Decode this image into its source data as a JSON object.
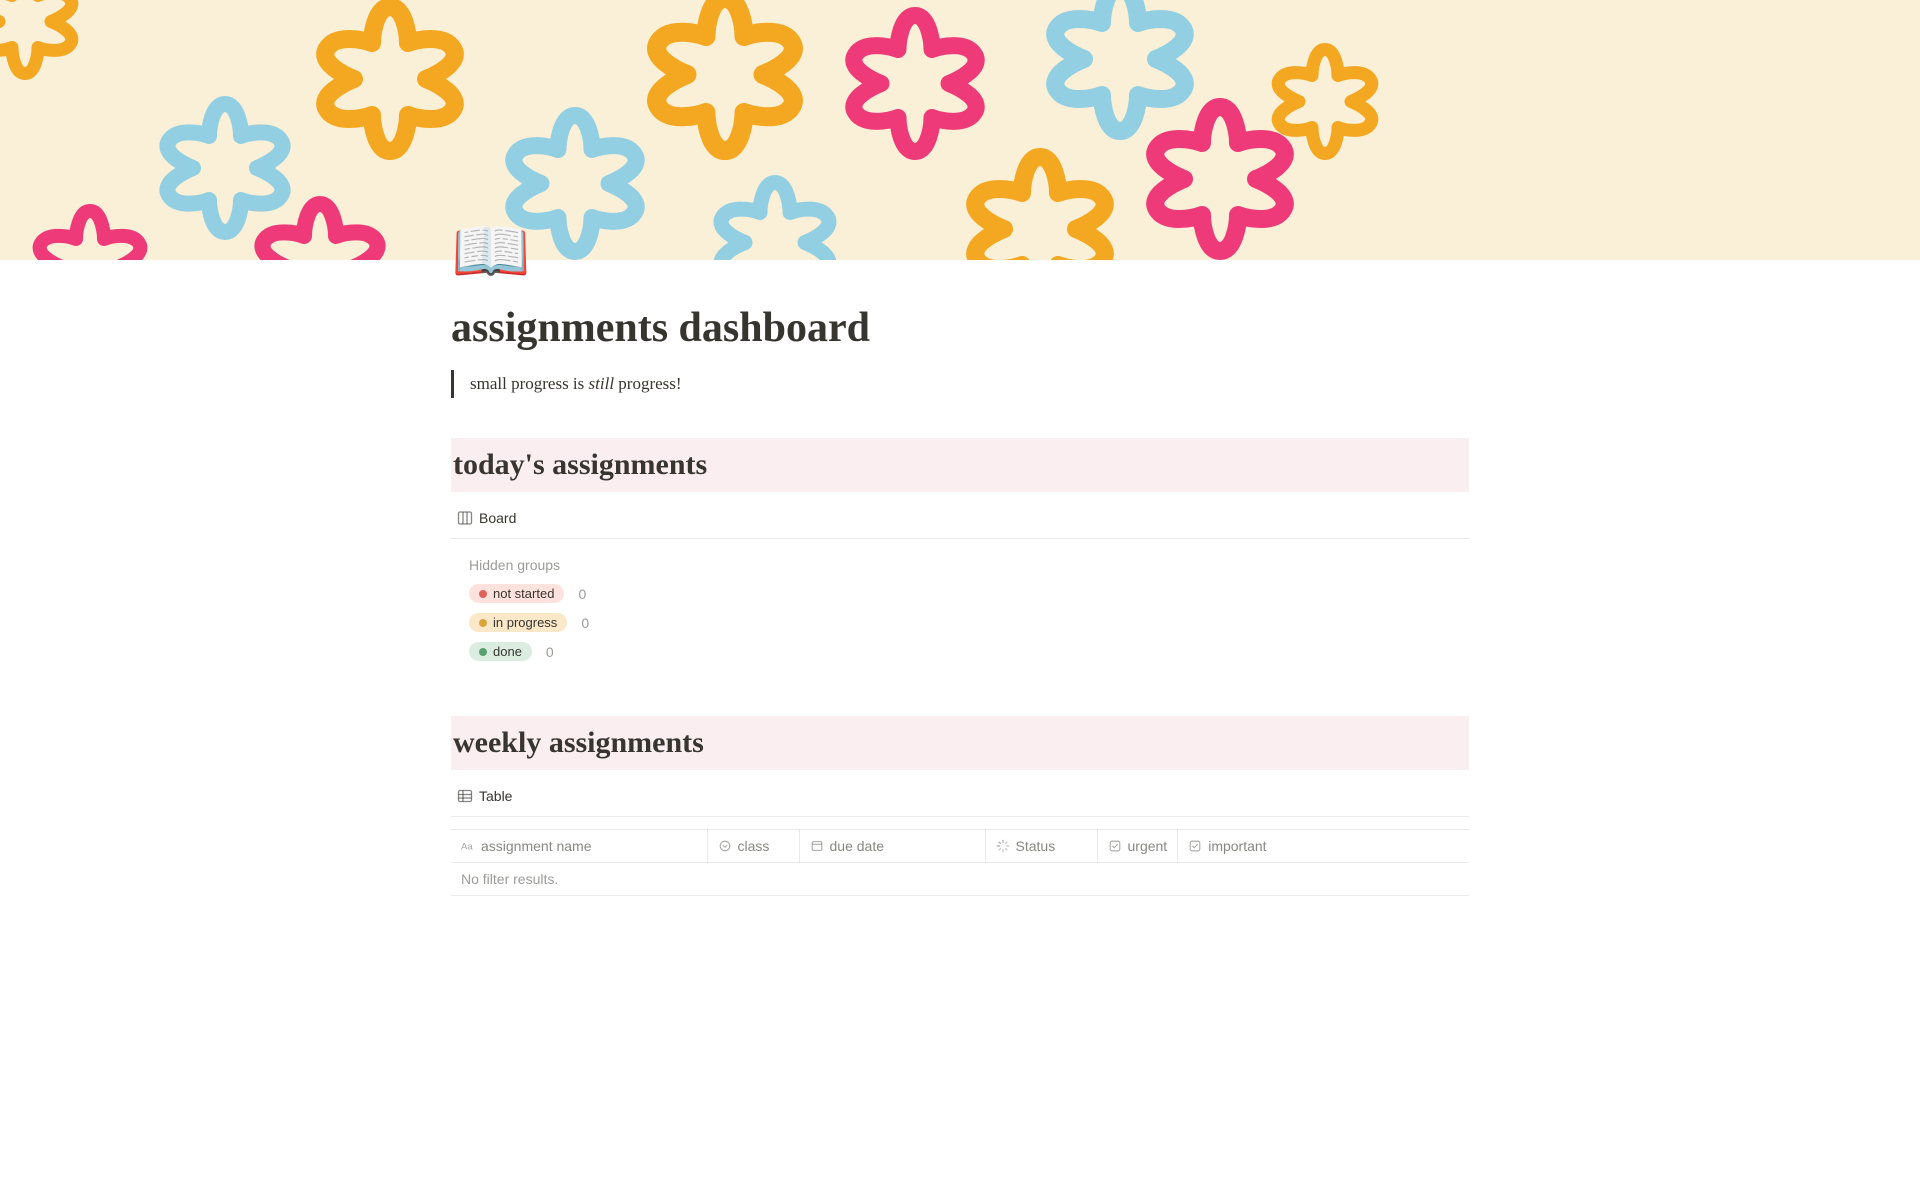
{
  "icon": "📖",
  "title": "assignments dashboard",
  "quote_pre": "small progress is ",
  "quote_italic": "still",
  "quote_post": " progress!",
  "section_today": {
    "heading": "today's assignments",
    "view_label": "Board",
    "hidden_groups_label": "Hidden groups",
    "groups": [
      {
        "label": "not started",
        "count": "0",
        "pill_class": "pill-red"
      },
      {
        "label": "in progress",
        "count": "0",
        "pill_class": "pill-yellow"
      },
      {
        "label": "done",
        "count": "0",
        "pill_class": "pill-green"
      }
    ]
  },
  "section_weekly": {
    "heading": "weekly assignments",
    "view_label": "Table",
    "columns": {
      "name": "assignment name",
      "class": "class",
      "due": "due date",
      "status": "Status",
      "urgent": "urgent",
      "important": "important"
    },
    "empty_message": "No filter results."
  }
}
